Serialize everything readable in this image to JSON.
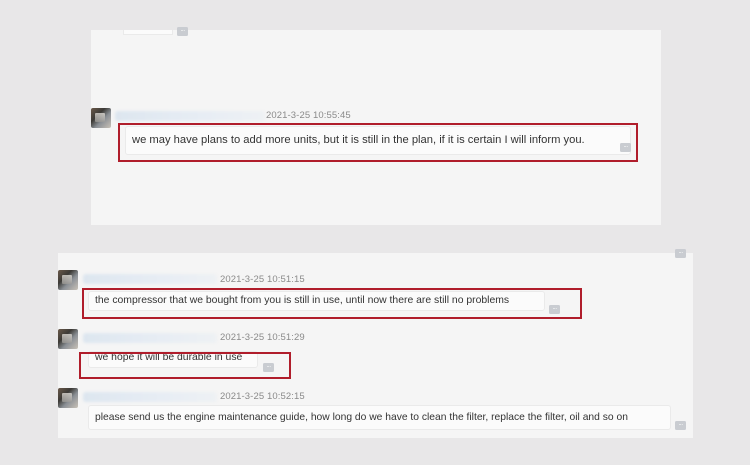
{
  "colors": {
    "background": "#e8e7e8",
    "panel": "#f5f5f5",
    "highlight": "#b01d2b",
    "timestamp": "#8a8a8a",
    "text": "#333333"
  },
  "icons": {
    "more": "more-options-icon",
    "avatar": "user-avatar"
  },
  "top_chat": {
    "messages": [
      {
        "time": "2021-3-25 10:55:45",
        "text": "we may have plans to add more units, but it is still in the plan, if it is certain I will inform you."
      }
    ]
  },
  "bottom_chat": {
    "messages": [
      {
        "time": "2021-3-25 10:51:15",
        "text": "the compressor that we bought from you is still in use, until now there are still no problems"
      },
      {
        "time": "2021-3-25 10:51:29",
        "text": "we hope it will be durable in use"
      },
      {
        "time": "2021-3-25 10:52:15",
        "text": "please send us the engine maintenance guide, how long do we have to clean the filter, replace the filter, oil and so on"
      }
    ]
  }
}
